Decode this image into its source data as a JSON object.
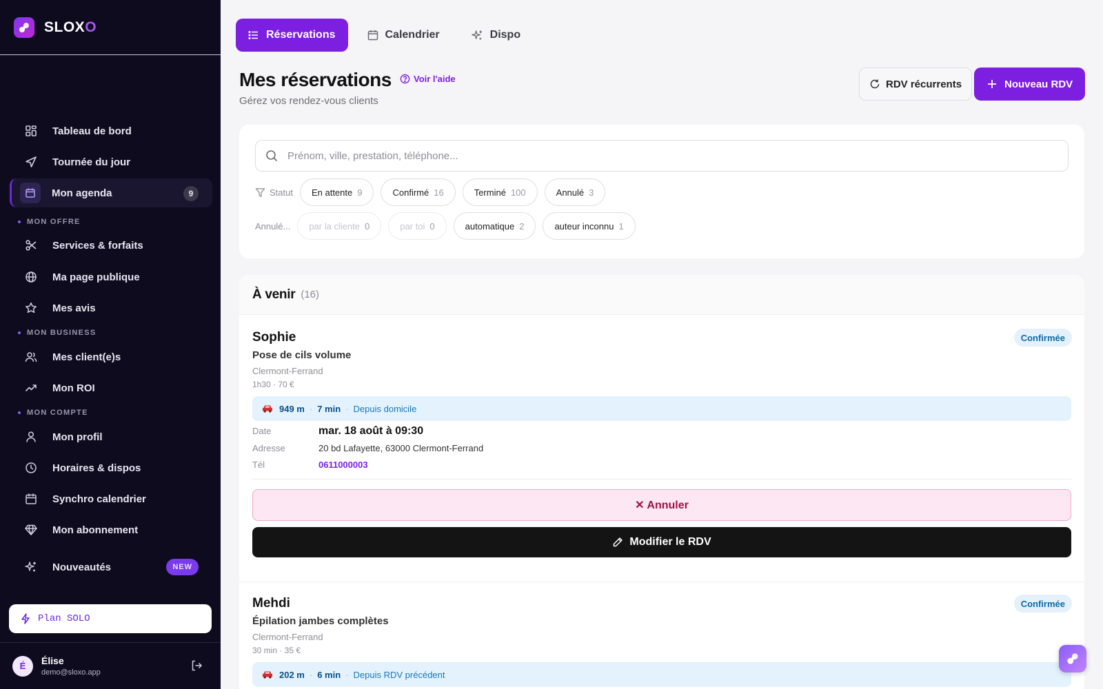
{
  "brand": {
    "name_main": "SLOX",
    "name_accent": "O"
  },
  "sidebar": {
    "items": [
      {
        "label": "Tableau de bord",
        "icon": "dashboard-icon"
      },
      {
        "label": "Tournée du jour",
        "icon": "navigation-icon"
      },
      {
        "label": "Mon agenda",
        "icon": "calendar-icon",
        "badge": "9",
        "active": true
      },
      {
        "label": "Services & forfaits",
        "icon": "scissors-icon"
      },
      {
        "label": "Ma page publique",
        "icon": "globe-icon"
      },
      {
        "label": "Mes avis",
        "icon": "star-icon"
      },
      {
        "label": "Mes client(e)s",
        "icon": "users-icon"
      },
      {
        "label": "Mon ROI",
        "icon": "trending-up-icon"
      },
      {
        "label": "Mon profil",
        "icon": "user-icon"
      },
      {
        "label": "Horaires & dispos",
        "icon": "clock-icon"
      },
      {
        "label": "Synchro calendrier",
        "icon": "calendar-sync-icon"
      },
      {
        "label": "Mon abonnement",
        "icon": "diamond-icon"
      },
      {
        "label": "Nouveautés",
        "icon": "sparkles-icon",
        "badge": "NEW"
      }
    ],
    "sections": [
      "MON OFFRE",
      "MON BUSINESS",
      "MON COMPTE"
    ],
    "plan": "Plan SOLO",
    "user": {
      "initial": "É",
      "name": "Élise",
      "email": "demo@sloxo.app"
    }
  },
  "tabs": [
    {
      "label": "Réservations",
      "icon": "list-icon",
      "active": true
    },
    {
      "label": "Calendrier",
      "icon": "calendar-icon"
    },
    {
      "label": "Dispo",
      "icon": "sparkles-icon"
    }
  ],
  "header": {
    "title": "Mes réservations",
    "help": "Voir l'aide",
    "subtitle": "Gérez vos rendez-vous clients",
    "recurring_button": "RDV récurrents",
    "new_button": "Nouveau RDV"
  },
  "filters": {
    "search_placeholder": "Prénom, ville, prestation, téléphone...",
    "status_label": "Statut",
    "status_chips": [
      {
        "label": "En attente",
        "count": "9"
      },
      {
        "label": "Confirmé",
        "count": "16"
      },
      {
        "label": "Terminé",
        "count": "100"
      },
      {
        "label": "Annulé",
        "count": "3"
      }
    ],
    "cancel_label": "Annulé...",
    "cancel_chips": [
      {
        "label": "par la cliente",
        "count": "0",
        "disabled": true
      },
      {
        "label": "par toi",
        "count": "0",
        "disabled": true
      },
      {
        "label": "automatique",
        "count": "2"
      },
      {
        "label": "auteur inconnu",
        "count": "1"
      }
    ]
  },
  "upcoming": {
    "title": "À venir",
    "count": "(16)",
    "bookings": [
      {
        "name": "Sophie",
        "service": "Pose de cils volume",
        "city": "Clermont-Ferrand",
        "meta": "1h30 · 70 €",
        "status": "Confirmée",
        "distance": "949 m",
        "duration": "7 min",
        "from": "Depuis domicile",
        "date_label": "Date",
        "date": "mar. 18 août à 09:30",
        "address_label": "Adresse",
        "address": "20 bd Lafayette, 63000 Clermont-Ferrand",
        "phone_label": "Tél",
        "phone": "0611000003",
        "cancel_button": "✕ Annuler",
        "edit_button": "Modifier le RDV"
      },
      {
        "name": "Mehdi",
        "service": "Épilation jambes complètes",
        "city": "Clermont-Ferrand",
        "meta": "30 min · 35 €",
        "status": "Confirmée",
        "distance": "202 m",
        "duration": "6 min",
        "from": "Depuis RDV précédent"
      }
    ]
  },
  "colors": {
    "accent": "#7c1fe0",
    "sidebar_bg": "#0e0b1f",
    "status_bg": "#e4f1fa",
    "cancel_bg": "#fce7f3"
  }
}
